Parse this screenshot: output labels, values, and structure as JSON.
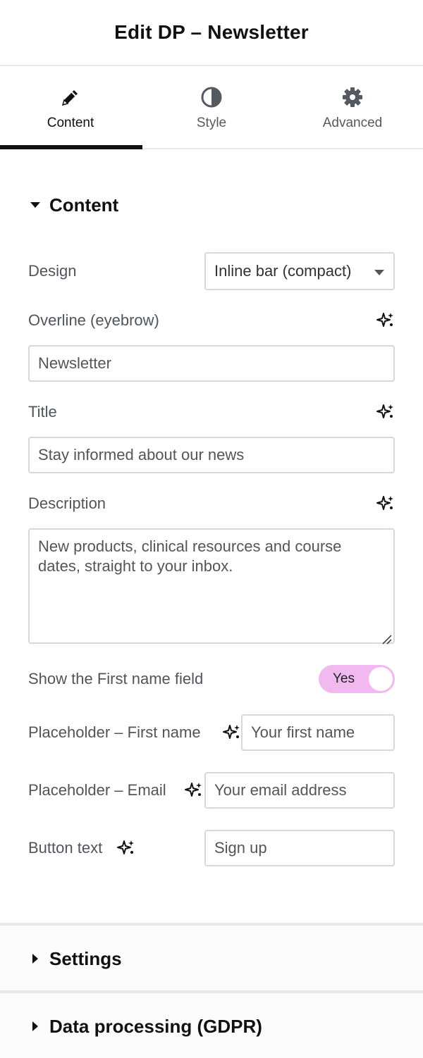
{
  "header": {
    "title": "Edit DP – Newsletter"
  },
  "tabs": [
    {
      "label": "Content",
      "icon": "pencil-icon",
      "active": true
    },
    {
      "label": "Style",
      "icon": "half-circle-icon",
      "active": false
    },
    {
      "label": "Advanced",
      "icon": "gear-icon",
      "active": false
    }
  ],
  "content": {
    "section_title": "Content",
    "design": {
      "label": "Design",
      "value": "Inline bar (compact)"
    },
    "overline": {
      "label": "Overline (eyebrow)",
      "value": "Newsletter"
    },
    "title": {
      "label": "Title",
      "value": "Stay informed about our news"
    },
    "description": {
      "label": "Description",
      "value": "New products, clinical resources and course dates, straight to your inbox."
    },
    "show_first_name": {
      "label": "Show the First name field",
      "toggle": "Yes"
    },
    "placeholder_first_name": {
      "label": "Placeholder – First name",
      "value": "Your first name"
    },
    "placeholder_email": {
      "label": "Placeholder – Email",
      "value": "Your email address"
    },
    "button_text": {
      "label": "Button text",
      "value": "Sign up"
    }
  },
  "collapsed_sections": [
    {
      "title": "Settings"
    },
    {
      "title": "Data processing (GDPR)"
    }
  ],
  "colors": {
    "accent_toggle": "#f2b8f0",
    "indicator": "#111111",
    "border": "#d5d8dc"
  }
}
